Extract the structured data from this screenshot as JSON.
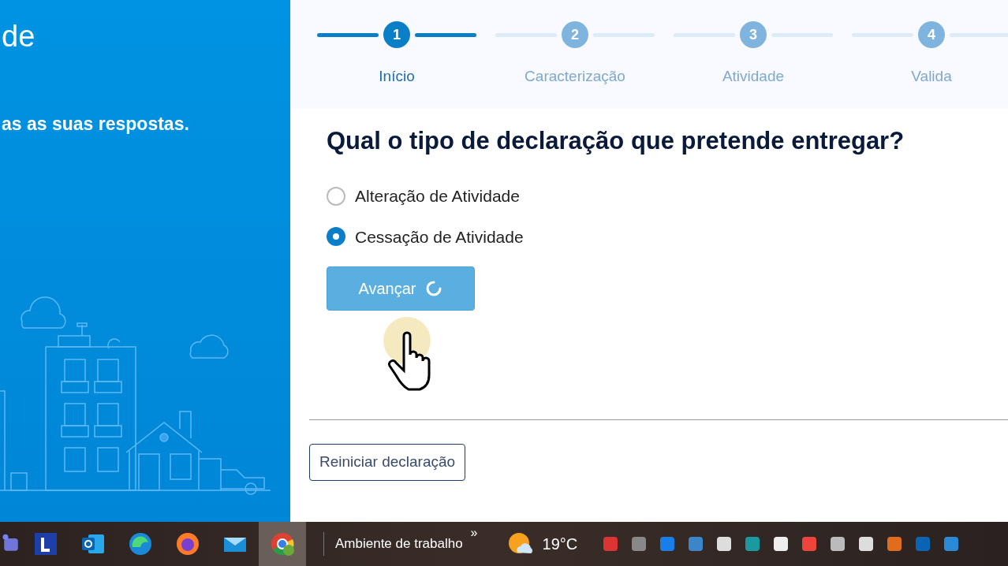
{
  "left_panel": {
    "title_fragment": "de",
    "subtitle_fragment": "as as suas respostas."
  },
  "stepper": [
    {
      "number": "1",
      "label": "Início",
      "selected": true
    },
    {
      "number": "2",
      "label": "Caracterização",
      "selected": false
    },
    {
      "number": "3",
      "label": "Atividade",
      "selected": false
    },
    {
      "number": "4",
      "label": "Valida",
      "selected": false
    }
  ],
  "question": "Qual o tipo de declaração que pretende entregar?",
  "options": [
    {
      "label": "Alteração de Atividade",
      "selected": false
    },
    {
      "label": "Cessação de Atividade",
      "selected": true
    }
  ],
  "next_button": {
    "label": "Avançar",
    "loading": true
  },
  "reset_button": {
    "label": "Reiniciar declaração"
  },
  "taskbar": {
    "apps": [
      {
        "kind": "teams",
        "selected": false
      },
      {
        "kind": "letter",
        "selected": false
      },
      {
        "kind": "outlook",
        "selected": false
      },
      {
        "kind": "edge",
        "selected": false
      },
      {
        "kind": "firefox",
        "selected": false
      },
      {
        "kind": "mail",
        "selected": false
      },
      {
        "kind": "chrome",
        "selected": true
      }
    ],
    "toolbar_label": "Ambiente de trabalho",
    "toolbar_chevron": "»",
    "temperature": "19°C"
  }
}
